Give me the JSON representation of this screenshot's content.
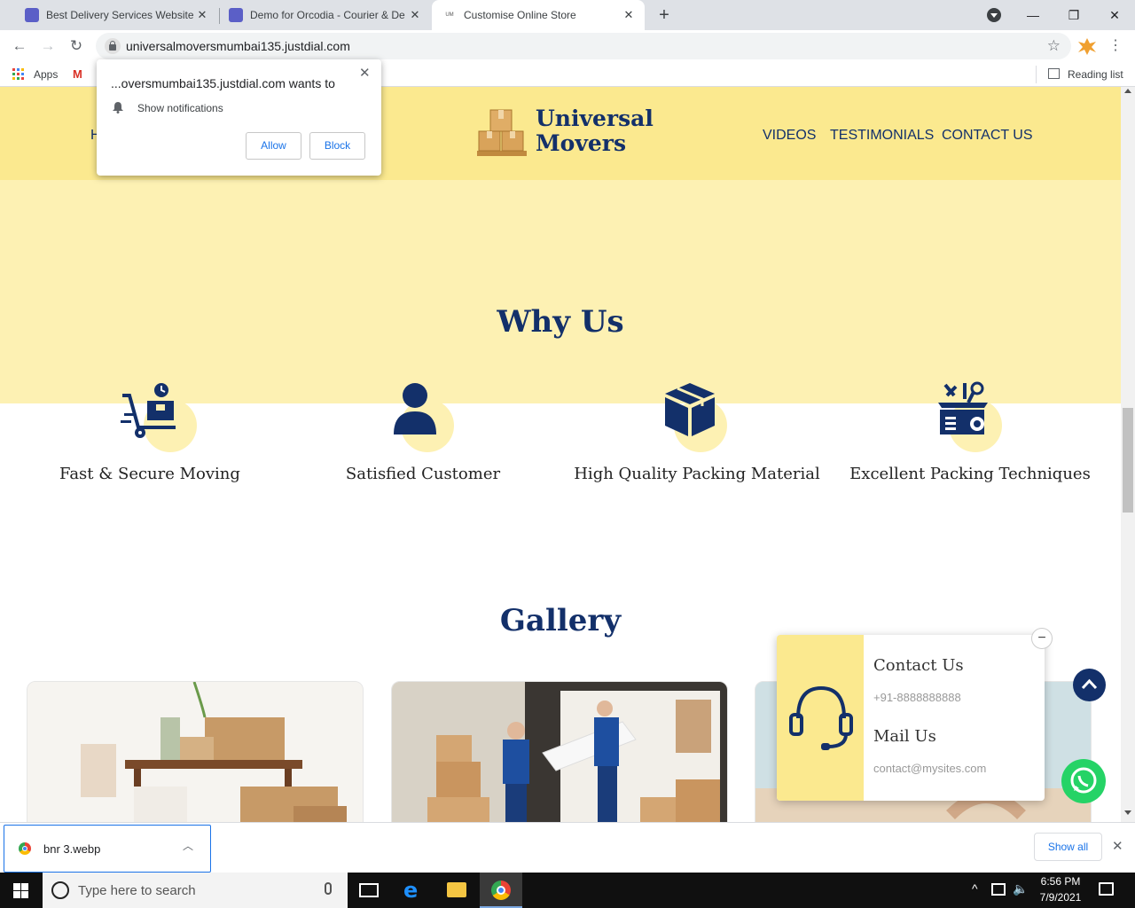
{
  "browser": {
    "tabs": [
      {
        "title": "Best Delivery Services Website Te",
        "active": false
      },
      {
        "title": "Demo for Orcodia - Courier & De",
        "active": false
      },
      {
        "title": "Customise Online Store",
        "active": true,
        "favicon_text": "UM"
      }
    ],
    "new_tab": "+",
    "url": "universalmoversmumbai135.justdial.com",
    "bookmarks": {
      "apps": "Apps",
      "reading_list": "Reading list"
    }
  },
  "notification_prompt": {
    "origin": "...oversmumbai135.justdial.com wants to",
    "permission": "Show notifications",
    "allow": "Allow",
    "block": "Block"
  },
  "site": {
    "brand_line1": "Universal",
    "brand_line2": "Movers",
    "nav_partial": "H",
    "nav": [
      "VIDEOS",
      "TESTIMONIALS",
      "CONTACT US"
    ],
    "why_title": "Why Us",
    "features": [
      {
        "label": "Fast & Secure Moving",
        "icon": "hand-truck-delivery-icon"
      },
      {
        "label": "Satisfied Customer",
        "icon": "user-icon"
      },
      {
        "label": "High Quality Packing Material",
        "icon": "box-icon"
      },
      {
        "label": "Excellent Packing Techniques",
        "icon": "toolbox-icon"
      }
    ],
    "gallery_title": "Gallery"
  },
  "contact_widget": {
    "contact_title": "Contact Us",
    "phone": "+91-8888888888",
    "mail_title": "Mail Us",
    "email": "contact@mysites.com"
  },
  "download": {
    "filename": "bnr 3.webp",
    "show_all": "Show all"
  },
  "taskbar": {
    "search_placeholder": "Type here to search",
    "time": "6:56 PM",
    "date": "7/9/2021"
  },
  "colors": {
    "navy": "#13306a",
    "header_yellow": "#fbe98f",
    "hero_yellow": "#fdf1b3",
    "whatsapp_green": "#25d366"
  }
}
